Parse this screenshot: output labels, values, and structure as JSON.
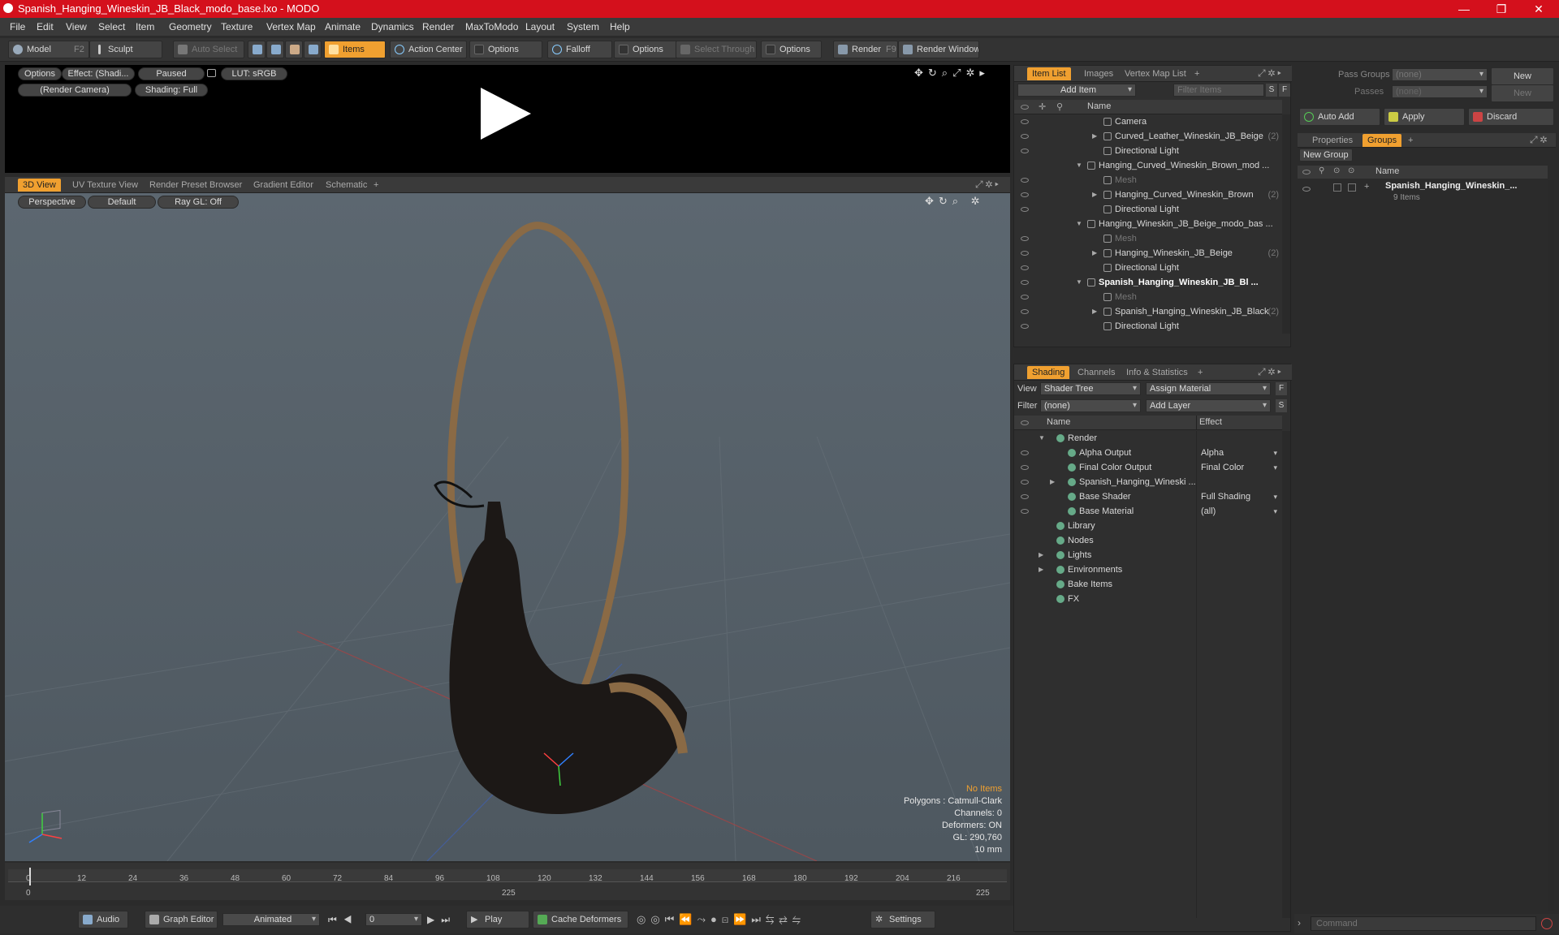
{
  "window": {
    "title": "Spanish_Hanging_Wineskin_JB_Black_modo_base.lxo - MODO",
    "minimize": "—",
    "maximize": "❐",
    "close": "✕"
  },
  "menu": [
    "File",
    "Edit",
    "View",
    "Select",
    "Item",
    "Geometry",
    "Texture",
    "Vertex Map",
    "Animate",
    "Dynamics",
    "Render",
    "MaxToModo",
    "Layout",
    "System",
    "Help"
  ],
  "toolbar": {
    "model": "Model",
    "model_key": "F2",
    "sculpt": "Sculpt",
    "auto_select": "Auto Select",
    "items": "Items",
    "action_center": "Action Center",
    "options1": "Options",
    "falloff": "Falloff",
    "options2": "Options",
    "select_through": "Select Through",
    "options3": "Options",
    "render": "Render",
    "render_key": "F9",
    "render_window": "Render Window"
  },
  "preview": {
    "options": "Options",
    "effect": "Effect: (Shadi...",
    "paused": "Paused",
    "lut": "LUT: sRGB",
    "camera": "(Render Camera)",
    "shading": "Shading: Full"
  },
  "viewport_tabs": [
    "3D View",
    "UV Texture View",
    "Render Preset Browser",
    "Gradient Editor",
    "Schematic",
    "+"
  ],
  "viewport": {
    "perspective": "Perspective",
    "default": "Default",
    "raygl": "Ray GL: Off",
    "hud": {
      "no_items": "No Items",
      "polygons": "Polygons : Catmull-Clark",
      "channels": "Channels: 0",
      "deformers": "Deformers: ON",
      "gl": "GL: 290,760",
      "scale": "10 mm"
    }
  },
  "timeline": {
    "ticks": [
      "0",
      "12",
      "24",
      "36",
      "48",
      "60",
      "72",
      "84",
      "96",
      "108",
      "120",
      "132",
      "144",
      "156",
      "168",
      "180",
      "192",
      "204",
      "216"
    ],
    "start": "0",
    "mid": "225",
    "end": "225"
  },
  "bottombar": {
    "audio": "Audio",
    "graph_editor": "Graph Editor",
    "animated": "Animated",
    "frame": "0",
    "play": "Play",
    "cache_deformers": "Cache Deformers",
    "settings": "Settings"
  },
  "item_list": {
    "tabs": [
      "Item List",
      "Images",
      "Vertex Map List",
      "+"
    ],
    "add_item": "Add Item",
    "filter_items": "Filter Items",
    "s": "S",
    "f": "F",
    "col_name": "Name",
    "rows": [
      {
        "label": "Camera",
        "indent": 1,
        "eye": true
      },
      {
        "label": "Curved_Leather_Wineskin_JB_Beige",
        "suffix": "(2)",
        "indent": 1,
        "eye": true,
        "arrow": "▶"
      },
      {
        "label": "Directional Light",
        "indent": 1,
        "eye": true
      },
      {
        "label": "Hanging_Curved_Wineskin_Brown_mod ...",
        "indent": 0,
        "eye": false,
        "arrow": "▼"
      },
      {
        "label": "Mesh",
        "indent": 1,
        "eye": true,
        "dim": true
      },
      {
        "label": "Hanging_Curved_Wineskin_Brown",
        "suffix": "(2)",
        "indent": 1,
        "eye": true,
        "arrow": "▶"
      },
      {
        "label": "Directional Light",
        "indent": 1,
        "eye": true
      },
      {
        "label": "Hanging_Wineskin_JB_Beige_modo_bas ...",
        "indent": 0,
        "eye": false,
        "arrow": "▼"
      },
      {
        "label": "Mesh",
        "indent": 1,
        "eye": true,
        "dim": true
      },
      {
        "label": "Hanging_Wineskin_JB_Beige",
        "suffix": "(2)",
        "indent": 1,
        "eye": true,
        "arrow": "▶"
      },
      {
        "label": "Directional Light",
        "indent": 1,
        "eye": true
      },
      {
        "label": "Spanish_Hanging_Wineskin_JB_Bl ...",
        "indent": 0,
        "eye": true,
        "arrow": "▼",
        "bold": true
      },
      {
        "label": "Mesh",
        "indent": 1,
        "eye": true,
        "dim": true
      },
      {
        "label": "Spanish_Hanging_Wineskin_JB_Black",
        "suffix": "(2)",
        "indent": 1,
        "eye": true,
        "arrow": "▶"
      },
      {
        "label": "Directional Light",
        "indent": 1,
        "eye": true
      }
    ]
  },
  "shading": {
    "tabs": [
      "Shading",
      "Channels",
      "Info & Statistics",
      "+"
    ],
    "view_label": "View",
    "view_value": "Shader Tree",
    "assign_material": "Assign Material",
    "filter_label": "Filter",
    "filter_value": "(none)",
    "add_layer": "Add Layer",
    "f": "F",
    "s": "S",
    "col_name": "Name",
    "col_effect": "Effect",
    "rows": [
      {
        "label": "Render",
        "effect": "",
        "indent": 0,
        "arrow": "▼",
        "eye": false
      },
      {
        "label": "Alpha Output",
        "effect": "Alpha",
        "indent": 1,
        "eye": true
      },
      {
        "label": "Final Color Output",
        "effect": "Final Color",
        "indent": 1,
        "eye": true
      },
      {
        "label": "Spanish_Hanging_Wineski ...",
        "effect": "",
        "indent": 1,
        "arrow": "▶",
        "eye": true
      },
      {
        "label": "Base Shader",
        "effect": "Full Shading",
        "indent": 1,
        "eye": true
      },
      {
        "label": "Base Material",
        "effect": "(all)",
        "indent": 1,
        "eye": true
      },
      {
        "label": "Library",
        "effect": "",
        "indent": 0,
        "eye": false
      },
      {
        "label": "Nodes",
        "effect": "",
        "indent": 0,
        "eye": false
      },
      {
        "label": "Lights",
        "effect": "",
        "indent": 0,
        "arrow": "▶",
        "eye": false
      },
      {
        "label": "Environments",
        "effect": "",
        "indent": 0,
        "arrow": "▶",
        "eye": false
      },
      {
        "label": "Bake Items",
        "effect": "",
        "indent": 0,
        "eye": false
      },
      {
        "label": "FX",
        "effect": "",
        "indent": 0,
        "eye": false
      }
    ]
  },
  "right_panel": {
    "pass_groups": "Pass Groups",
    "pass_groups_value": "(none)",
    "new1": "New",
    "passes": "Passes",
    "passes_value": "(none)",
    "new2": "New",
    "auto_add": "Auto Add",
    "apply": "Apply",
    "discard": "Discard",
    "tabs": [
      "Properties",
      "Groups",
      "+"
    ],
    "new_group": "New Group",
    "col_name": "Name",
    "group_name": "Spanish_Hanging_Wineskin_...",
    "group_count": "9 Items",
    "command_placeholder": "Command"
  },
  "colors": {
    "accent": "#f0a030",
    "title_red": "#d4101c"
  }
}
